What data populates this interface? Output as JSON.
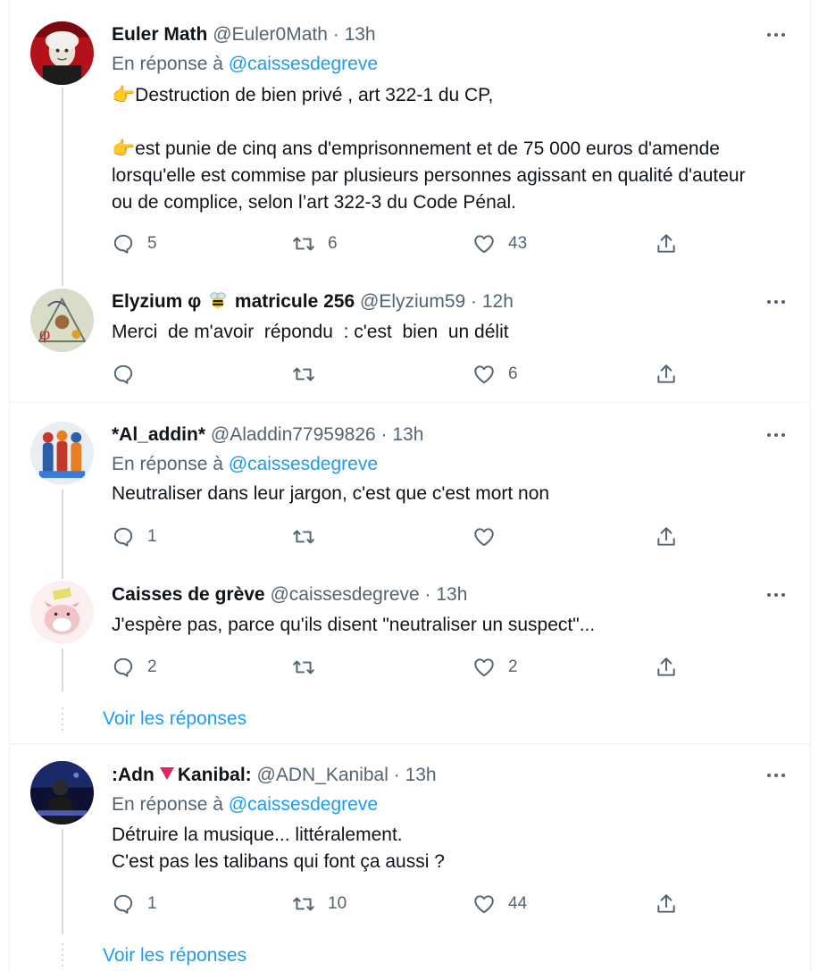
{
  "tweets": [
    {
      "name": "Euler Math",
      "handle": "@Euler0Math · 13h",
      "reply_prefix": "En réponse à",
      "reply_to": "@caissesdegreve",
      "line1": "👉Destruction de bien privé , art 322-1 du CP,",
      "line2": "👉est punie de cinq ans d'emprisonnement et de 75 000 euros d'amende\nlorsqu'elle est commise par plusieurs personnes agissant en qualité d'auteur\nou de complice, selon l’art 322-3 du Code Pénal.",
      "replies": "5",
      "retweets": "6",
      "likes": "43",
      "avatar_icon": "portrait-avatar"
    },
    {
      "name": "Elyzium φ",
      "name_suffix": "matricule 256",
      "handle": "@Elyzium59 · 12h",
      "text": "Merci  de m'avoir  répondu  : c'est  bien  un délit",
      "replies": "",
      "retweets": "",
      "likes": "6",
      "avatar_icon": "drawing-avatar"
    },
    {
      "name": "*Al_addin*",
      "handle": "@Aladdin77959826 · 13h",
      "reply_prefix": "En réponse à",
      "reply_to": "@caissesdegreve",
      "text": "Neutraliser dans leur jargon, c'est que c'est mort non",
      "replies": "1",
      "retweets": "",
      "likes": "",
      "avatar_icon": "figures-avatar"
    },
    {
      "name": "Caisses de grève",
      "handle": "@caissesdegreve · 13h",
      "text": "J'espère pas, parce qu'ils disent \"neutraliser un suspect\"...",
      "replies": "2",
      "retweets": "",
      "likes": "2",
      "avatar_icon": "piggy-bank-avatar"
    },
    {
      "name": ":Adn",
      "name_suffix": "Kanibal:",
      "handle": "@ADN_Kanibal · 13h",
      "reply_prefix": "En réponse à",
      "reply_to": "@caissesdegreve",
      "text": "Détruire la musique... littéralement.\nC'est pas les talibans qui font ça aussi ?",
      "replies": "1",
      "retweets": "10",
      "likes": "44",
      "avatar_icon": "dj-avatar"
    }
  ],
  "show_replies_label": "Voir les réponses",
  "colors": {
    "link": "#1d9bf0",
    "secondary": "#536471",
    "border": "#eff3f4",
    "thread": "#cfd9de"
  }
}
